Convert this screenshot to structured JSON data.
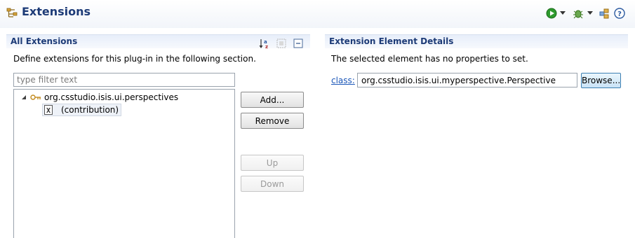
{
  "header": {
    "title": "Extensions",
    "icons": [
      "extensions-icon",
      "run-icon",
      "dropdown-arrow-icon",
      "debug-icon",
      "dropdown-arrow-icon",
      "plugin-icon",
      "help-icon"
    ]
  },
  "left_section": {
    "title": "All Extensions",
    "description": "Define extensions for this plug-in in the following section.",
    "filter_placeholder": "type filter text",
    "toolbar_icons": [
      "sort-alpha-icon",
      "show-name-icon",
      "collapse-all-icon"
    ],
    "tree": [
      {
        "label": "org.csstudio.isis.ui.perspectives",
        "icon": "extension-point-icon",
        "expanded": true,
        "level": 0
      },
      {
        "label": "(contribution)",
        "icon": "x-element-icon",
        "level": 1,
        "selected": true
      }
    ],
    "buttons": {
      "add": "Add...",
      "remove": "Remove",
      "up": "Up",
      "down": "Down"
    }
  },
  "right_section": {
    "title": "Extension Element Details",
    "message": "The selected element has no properties to set.",
    "class_label": "class:",
    "class_value": "org.csstudio.isis.ui.myperspective.Perspective",
    "browse_label": "Browse..."
  },
  "colors": {
    "title": "#1d3b77",
    "section_bg": "#e7eefa",
    "link": "#1a56b8",
    "run_green": "#2e9a2e"
  }
}
